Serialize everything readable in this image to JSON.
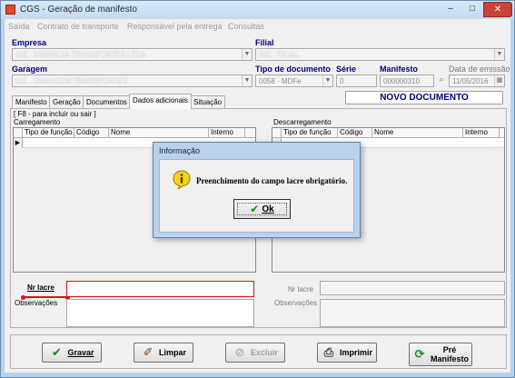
{
  "window": {
    "title": "CGS - Geração de manifesto",
    "min": "–",
    "max": "□",
    "close": "✕"
  },
  "menu": [
    "Saída",
    "Contrato de transporte",
    "Responsável pela entrega",
    "Consultas"
  ],
  "form": {
    "empresa_label": "Empresa",
    "empresa_value": "001 - EMPRESA TRANSPORTES LTDA",
    "filial_label": "Filial",
    "filial_value": "001 - FILIAL",
    "garagem_label": "Garagem",
    "garagem_value": "001 - GARAGEM TRANSPORTES",
    "tipo_doc_label": "Tipo de documento",
    "tipo_doc_value": "0058 - MDFe",
    "serie_label": "Série",
    "serie_value": "0",
    "manifesto_label": "Manifesto",
    "manifesto_value": "000000310",
    "data_emissao_label": "Data de emissão",
    "data_emissao_value": "11/05/2016",
    "status_text": "NOVO DOCUMENTO"
  },
  "tabs": [
    "Manifesto",
    "Geração",
    "Documentos",
    "Dados adicionais",
    "Situação"
  ],
  "panel": {
    "hint": "[ F8 - para incluir ou sair ]",
    "carregamento_label": "Carregamento",
    "descarregamento_label": "Descarregamento",
    "columns": [
      "Tipo de função",
      "Código",
      "Nome",
      "Interno"
    ],
    "nr_lacre_label": "Nr lacre",
    "observacoes_label": "Observações"
  },
  "buttons": {
    "gravar": "Gravar",
    "limpar": "Limpar",
    "excluir": "Excluir",
    "imprimir": "Imprimir",
    "pre_manifesto_1": "Pré",
    "pre_manifesto_2": "Manifesto"
  },
  "dialog": {
    "title": "Informação",
    "message": "Preenchimento do campo lacre obrigatório.",
    "ok": "Ok"
  },
  "colors": {
    "accent_blue": "#000080",
    "window_frame": "#b9d1ea",
    "required_marker": "#e01010"
  }
}
